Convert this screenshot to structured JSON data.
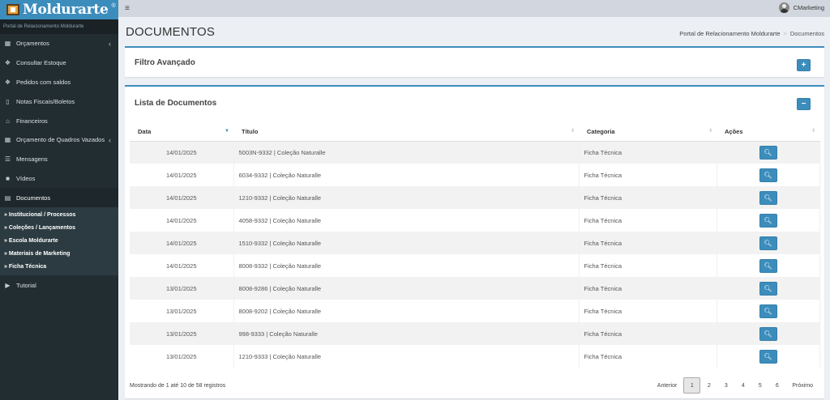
{
  "brand": {
    "name": "Moldurarte",
    "reg": "®",
    "portal_label": "Portal de Relacionamento Moldurarte"
  },
  "topbar": {
    "menu_icon": "≡",
    "user_name": "CMarketing"
  },
  "sidebar": {
    "items": [
      {
        "label": "Orçamentos",
        "icon": "grid-icon",
        "has_chevron": true
      },
      {
        "label": "Consultar Estoque",
        "icon": "cubes-icon",
        "has_chevron": false
      },
      {
        "label": "Pedidos com saldos",
        "icon": "cubes-icon",
        "has_chevron": false
      },
      {
        "label": "Notas Fiscais/Boletos",
        "icon": "file-icon",
        "has_chevron": false
      },
      {
        "label": "Financeiros",
        "icon": "bank-icon",
        "has_chevron": false
      },
      {
        "label": "Orçamento de Quadros Vazados",
        "icon": "grid-icon",
        "has_chevron": true
      },
      {
        "label": "Mensagens",
        "icon": "list-icon",
        "has_chevron": false
      },
      {
        "label": "Vídeos",
        "icon": "video-icon",
        "has_chevron": false
      },
      {
        "label": "Documentos",
        "icon": "document-icon",
        "has_chevron": false
      }
    ],
    "subitems": [
      "Institucional / Processos",
      "Coleções / Lançamentos",
      "Escola Moldurarte",
      "Materiais de Marketing",
      "Ficha Técnica"
    ],
    "last_item": {
      "label": "Tutorial",
      "icon": "play-icon"
    }
  },
  "page": {
    "title": "DOCUMENTOS"
  },
  "breadcrumb": {
    "home": "Portal de Relacionamento Moldurarte",
    "separator": ">",
    "current": "Documentos"
  },
  "filter_box": {
    "title": "Filtro Avançado",
    "button": "+"
  },
  "list_box": {
    "title": "Lista de Documentos",
    "button": "−"
  },
  "table": {
    "headers": [
      "Data",
      "Título",
      "Categoria",
      "Ações"
    ],
    "rows": [
      {
        "date": "14/01/2025",
        "title": "5003N-9332 | Coleção Naturalle",
        "category": "Ficha Técnica"
      },
      {
        "date": "14/01/2025",
        "title": "6034-9332 | Coleção Naturalle",
        "category": "Ficha Técnica"
      },
      {
        "date": "14/01/2025",
        "title": "1210-9332 | Coleção Naturalle",
        "category": "Ficha Técnica"
      },
      {
        "date": "14/01/2025",
        "title": "4058-9332 | Coleção Naturalle",
        "category": "Ficha Técnica"
      },
      {
        "date": "14/01/2025",
        "title": "1510-9332 | Coleção Naturalle",
        "category": "Ficha Técnica"
      },
      {
        "date": "14/01/2025",
        "title": "8008-9332 | Coleção Naturalle",
        "category": "Ficha Técnica"
      },
      {
        "date": "13/01/2025",
        "title": "8008-9286 | Coleção Naturalle",
        "category": "Ficha Técnica"
      },
      {
        "date": "13/01/2025",
        "title": "8008-9202 | Coleção Naturalle",
        "category": "Ficha Técnica"
      },
      {
        "date": "13/01/2025",
        "title": "998-9333 | Coleção Naturalle",
        "category": "Ficha Técnica"
      },
      {
        "date": "13/01/2025",
        "title": "1210-9333 | Coleção Naturalle",
        "category": "Ficha Técnica"
      }
    ]
  },
  "pagination": {
    "info": "Mostrando de 1 até 10 de 58 registros",
    "prev": "Anterior",
    "pages": [
      "1",
      "2",
      "3",
      "4",
      "5",
      "6"
    ],
    "current": "1",
    "next": "Próximo"
  },
  "colors": {
    "primary": "#3c8dbc",
    "sidebar": "#222d32",
    "topbar": "#d2d6de"
  }
}
